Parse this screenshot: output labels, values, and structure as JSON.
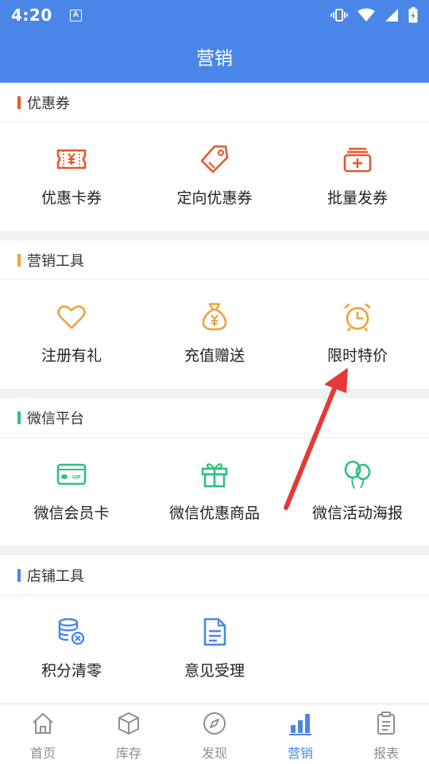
{
  "status_bar": {
    "time": "4:20",
    "a_badge": "A"
  },
  "header": {
    "title": "营销"
  },
  "colors": {
    "primary": "#4a86e8",
    "coupon": "#e8572c",
    "tool": "#f0a23a",
    "wechat": "#2fbf7f",
    "store": "#4a86e8",
    "arrow": "#e53935"
  },
  "sections": [
    {
      "title": "优惠券",
      "items": [
        {
          "label": "优惠卡券",
          "icon": "ticket-icon"
        },
        {
          "label": "定向优惠券",
          "icon": "tag-icon"
        },
        {
          "label": "批量发券",
          "icon": "batch-coupon-icon"
        }
      ]
    },
    {
      "title": "营销工具",
      "items": [
        {
          "label": "注册有礼",
          "icon": "heart-icon"
        },
        {
          "label": "充值赠送",
          "icon": "money-bag-icon"
        },
        {
          "label": "限时特价",
          "icon": "alarm-clock-icon"
        }
      ]
    },
    {
      "title": "微信平台",
      "items": [
        {
          "label": "微信会员卡",
          "icon": "vip-card-icon"
        },
        {
          "label": "微信优惠商品",
          "icon": "gift-icon"
        },
        {
          "label": "微信活动海报",
          "icon": "balloons-icon"
        }
      ]
    },
    {
      "title": "店铺工具",
      "items": [
        {
          "label": "积分清零",
          "icon": "coins-clear-icon"
        },
        {
          "label": "意见受理",
          "icon": "document-icon"
        }
      ]
    }
  ],
  "vip_text": "VIP",
  "tabs": [
    {
      "label": "首页",
      "icon": "home-icon"
    },
    {
      "label": "库存",
      "icon": "box-icon"
    },
    {
      "label": "发现",
      "icon": "compass-icon"
    },
    {
      "label": "营销",
      "icon": "bar-chart-icon",
      "active": true
    },
    {
      "label": "报表",
      "icon": "clipboard-icon"
    }
  ]
}
